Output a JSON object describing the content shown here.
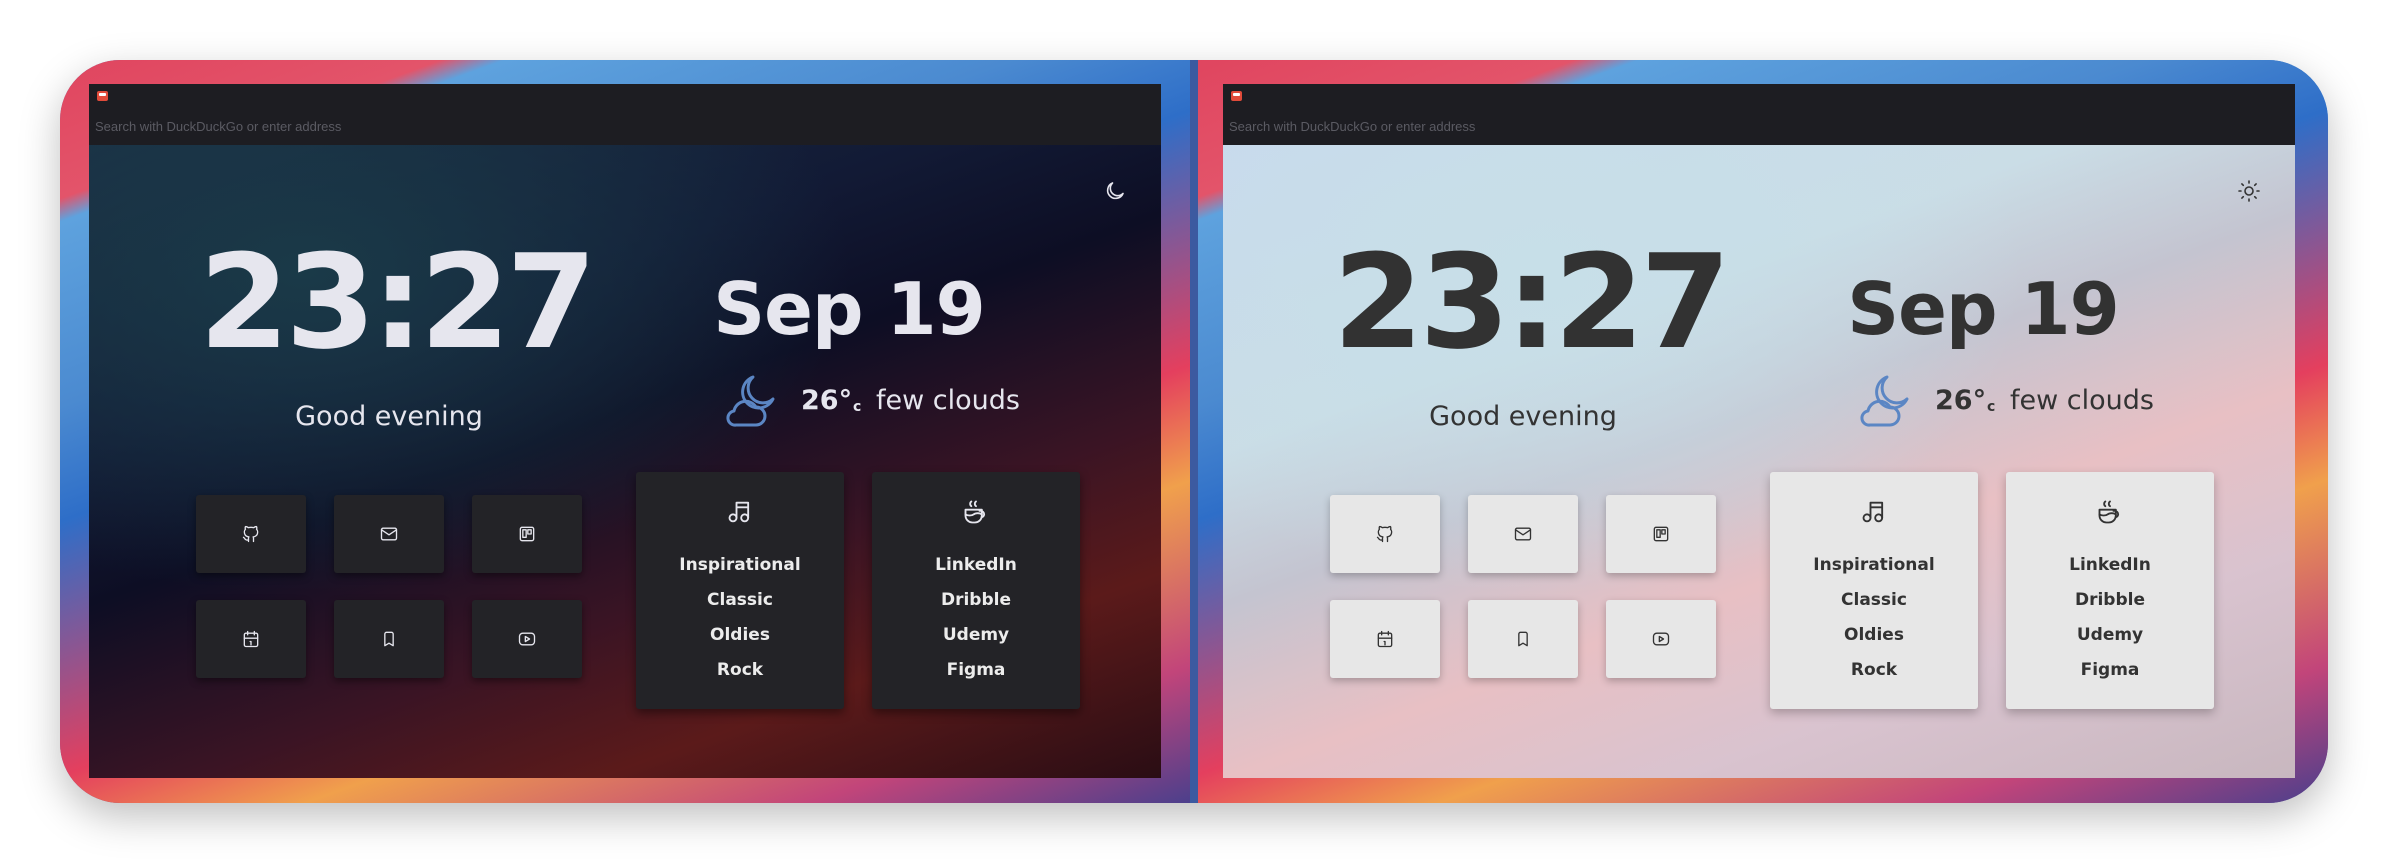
{
  "browser": {
    "url_placeholder": "Search with DuckDuckGo or enter address",
    "favicon": "calendar-favicon"
  },
  "panels": [
    {
      "theme": "dark",
      "theme_toggle_icon": "moon-icon",
      "clock": "23:27",
      "greeting": "Good evening",
      "date": "Sep 19",
      "weather": {
        "icon": "moon-cloud-icon",
        "temp": "26°",
        "unit": "c",
        "condition": "few clouds"
      },
      "shortcuts": [
        "github-icon",
        "mail-icon",
        "trello-icon",
        "calendar-icon",
        "bookmark-icon",
        "youtube-icon"
      ],
      "music_card": {
        "icon": "music-note-icon",
        "items": [
          "Inspirational",
          "Classic",
          "Oldies",
          "Rock"
        ]
      },
      "links_card": {
        "icon": "coffee-cup-icon",
        "items": [
          "LinkedIn",
          "Dribble",
          "Udemy",
          "Figma"
        ]
      }
    },
    {
      "theme": "light",
      "theme_toggle_icon": "sun-icon",
      "clock": "23:27",
      "greeting": "Good evening",
      "date": "Sep 19",
      "weather": {
        "icon": "moon-cloud-icon",
        "temp": "26°",
        "unit": "c",
        "condition": "few clouds"
      },
      "shortcuts": [
        "github-icon",
        "mail-icon",
        "trello-icon",
        "calendar-icon",
        "bookmark-icon",
        "youtube-icon"
      ],
      "music_card": {
        "icon": "music-note-icon",
        "items": [
          "Inspirational",
          "Classic",
          "Oldies",
          "Rock"
        ]
      },
      "links_card": {
        "icon": "coffee-cup-icon",
        "items": [
          "LinkedIn",
          "Dribble",
          "Udemy",
          "Figma"
        ]
      }
    }
  ],
  "colors": {
    "dark_card": "#232327",
    "light_card": "#e7e7e7",
    "weather_icon": "#5b86c4",
    "browser_bar": "#1d1d22"
  }
}
